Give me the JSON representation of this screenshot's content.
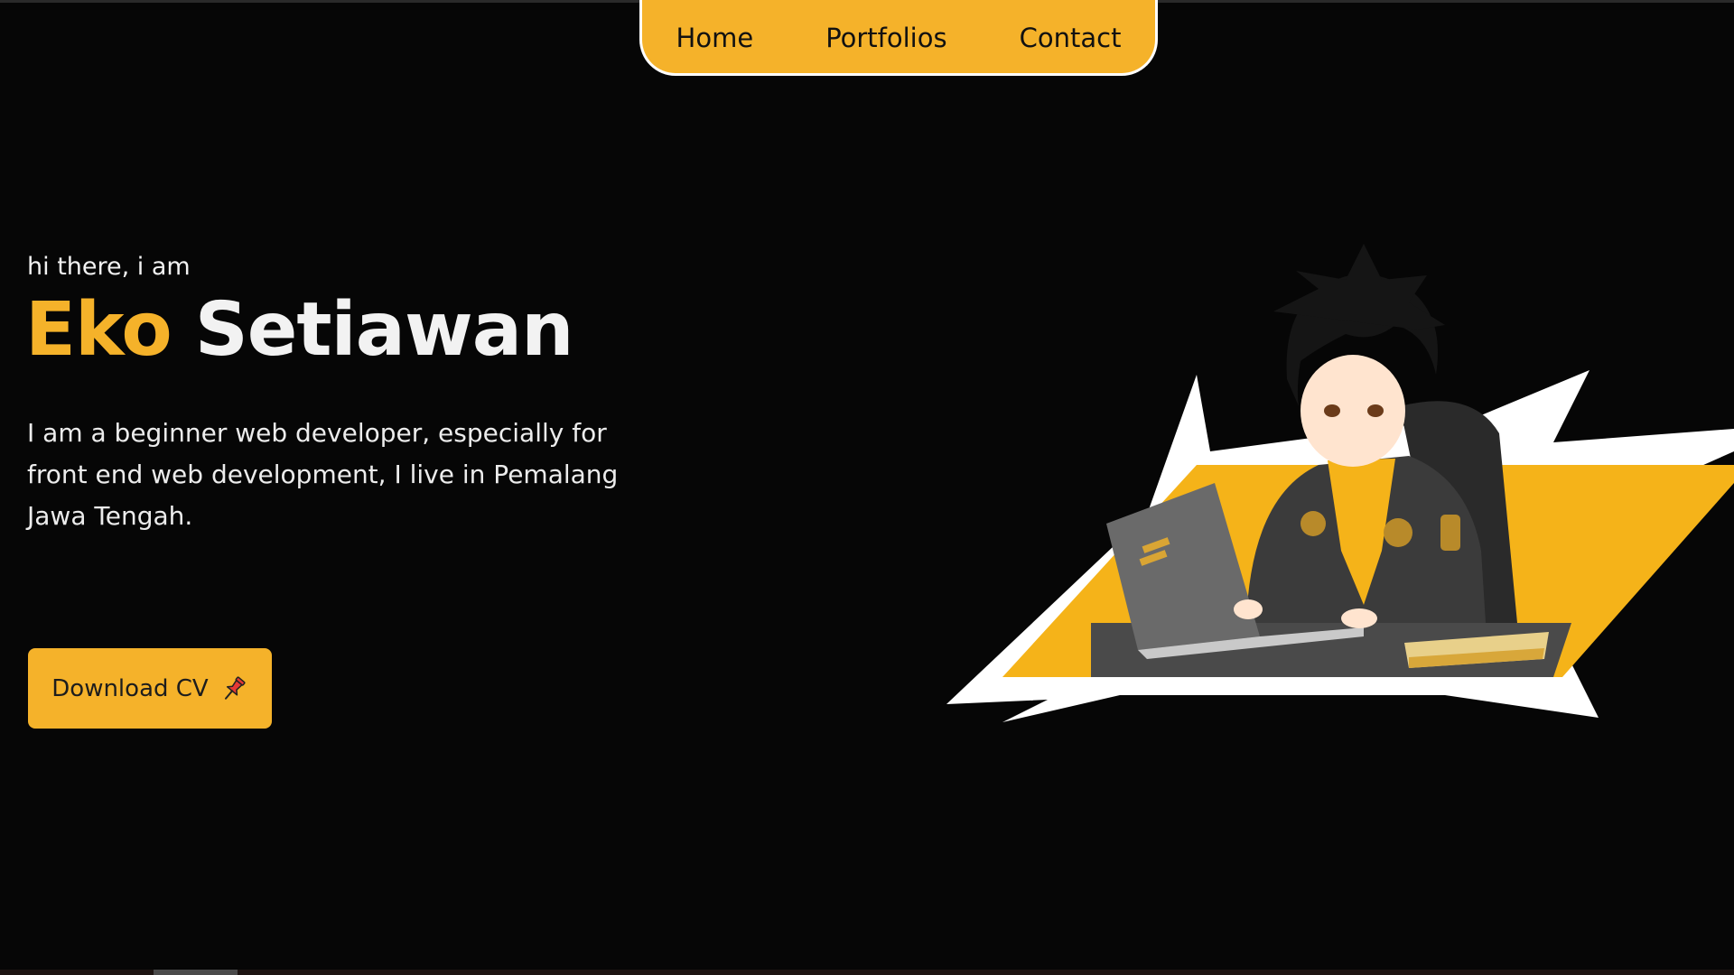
{
  "nav": {
    "items": [
      {
        "label": "Home"
      },
      {
        "label": "Portfolios"
      },
      {
        "label": "Contact"
      }
    ]
  },
  "hero": {
    "greeting": "hi there, i am",
    "first_name": "Eko",
    "last_name": "Setiawan",
    "description": "I am a beginner web developer, especially for front end web development, I live in Pemalang Jawa Tengah.",
    "cta_label": "Download CV",
    "cta_icon": "pushpin-icon",
    "illustration": "anime-developer-at-laptop"
  },
  "colors": {
    "background": "#060606",
    "accent": "#f5b22a",
    "text": "#f2f2f2"
  }
}
